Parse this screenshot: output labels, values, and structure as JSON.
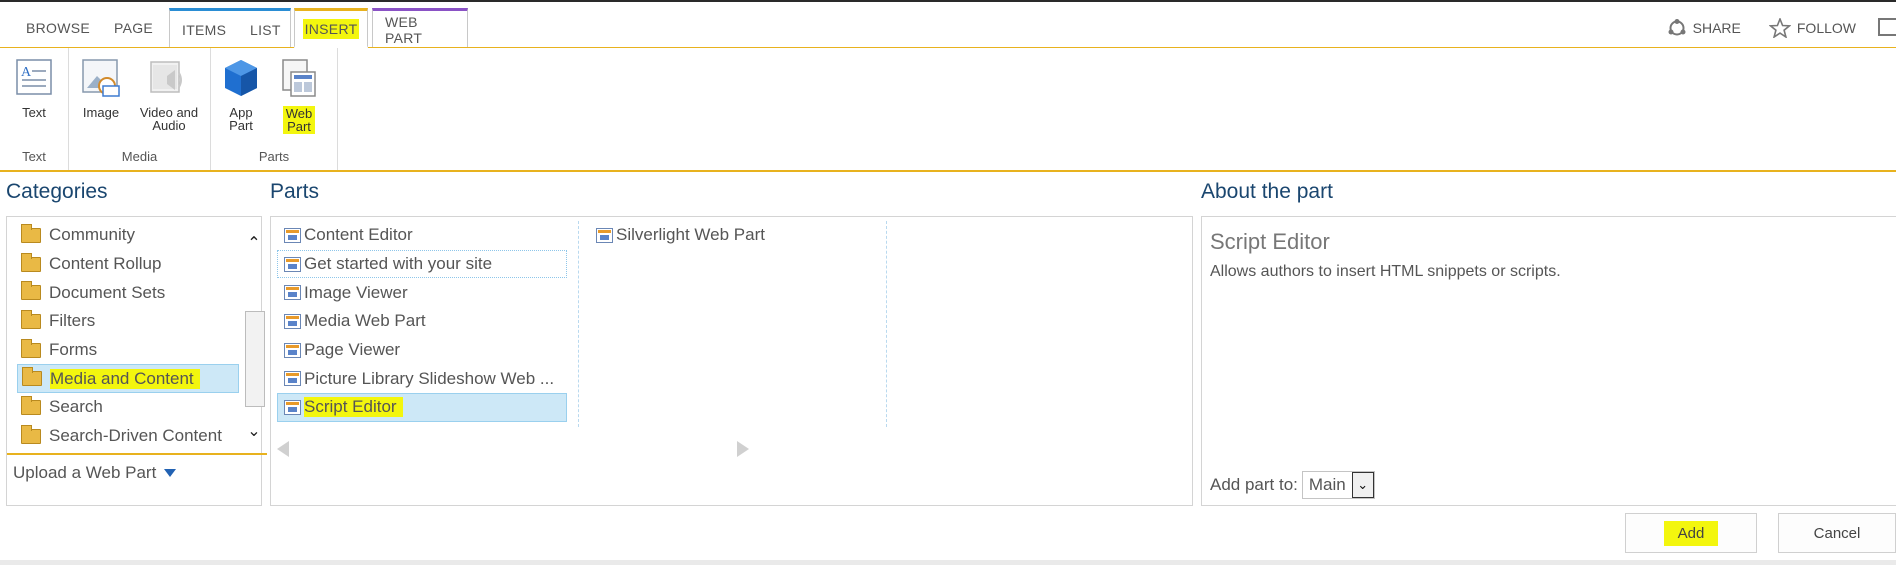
{
  "tabs": {
    "browse": "BROWSE",
    "page": "PAGE",
    "items": "ITEMS",
    "list": "LIST",
    "insert": "INSERT",
    "web_part": "WEB PART"
  },
  "actions": {
    "share": "SHARE",
    "follow": "FOLLOW"
  },
  "ribbon": {
    "groups": {
      "text": "Text",
      "media": "Media",
      "parts": "Parts"
    },
    "buttons": {
      "text": "Text",
      "image": "Image",
      "video_audio": "Video and\nAudio",
      "app_part": "App\nPart",
      "web_part": "Web\nPart"
    }
  },
  "headings": {
    "categories": "Categories",
    "parts": "Parts",
    "about": "About the part"
  },
  "categories": [
    "Community",
    "Content Rollup",
    "Document Sets",
    "Filters",
    "Forms",
    "Media and Content",
    "Search",
    "Search-Driven Content"
  ],
  "selected_category": "Media and Content",
  "upload_label": "Upload a Web Part",
  "parts_col1": [
    "Content Editor",
    "Get started with your site",
    "Image Viewer",
    "Media Web Part",
    "Page Viewer",
    "Picture Library Slideshow Web ...",
    "Script Editor"
  ],
  "parts_col2": [
    "Silverlight Web Part"
  ],
  "selected_part": "Script Editor",
  "about": {
    "title": "Script Editor",
    "description": "Allows authors to insert HTML snippets or scripts.",
    "add_to_label": "Add part to:",
    "add_to_value": "Main"
  },
  "buttons": {
    "add": "Add",
    "cancel": "Cancel"
  },
  "colors": {
    "insert_accent": "#e8b21e",
    "items_accent": "#2a8dd4",
    "webpart_accent": "#8a52c5",
    "highlight": "#f3f60e",
    "heading": "#1a466f",
    "selection": "#cde8f7"
  },
  "icons": [
    "share-icon",
    "star-icon",
    "text-icon",
    "image-icon",
    "video-audio-icon",
    "app-part-icon",
    "web-part-icon",
    "folder-icon",
    "web-part-item-icon",
    "scroll-up-icon",
    "scroll-down-icon",
    "prev-arrow-icon",
    "next-arrow-icon",
    "dropdown-caret-icon"
  ]
}
